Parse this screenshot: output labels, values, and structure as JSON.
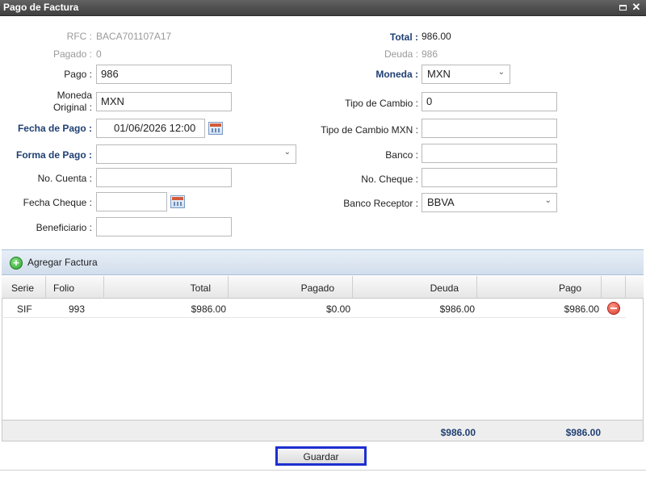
{
  "window": {
    "title": "Pago de Factura"
  },
  "form": {
    "rfc_label": "RFC :",
    "rfc_value": "BACA701107A17",
    "pagado_label": "Pagado :",
    "pagado_value": "0",
    "pago_label": "Pago :",
    "pago_value": "986",
    "moneda_original_label_1": "Moneda",
    "moneda_original_label_2": "Original :",
    "moneda_original_value": "MXN",
    "fecha_pago_label": "Fecha de Pago :",
    "fecha_pago_value": "01/06/2026 12:00",
    "forma_pago_label": "Forma de Pago :",
    "forma_pago_value": "",
    "no_cuenta_label": "No. Cuenta :",
    "no_cuenta_value": "",
    "fecha_cheque_label": "Fecha Cheque :",
    "fecha_cheque_value": "",
    "beneficiario_label": "Beneficiario :",
    "beneficiario_value": "",
    "total_label": "Total :",
    "total_value": "986.00",
    "deuda_label": "Deuda :",
    "deuda_value": "986",
    "moneda_label": "Moneda :",
    "moneda_value": "MXN",
    "tipo_cambio_label": "Tipo de Cambio :",
    "tipo_cambio_value": "0",
    "tipo_cambio_mxn_label": "Tipo de Cambio MXN :",
    "tipo_cambio_mxn_value": "",
    "banco_label": "Banco :",
    "banco_value": "",
    "no_cheque_label": "No. Cheque :",
    "no_cheque_value": "",
    "banco_receptor_label": "Banco Receptor :",
    "banco_receptor_value": "BBVA"
  },
  "invoices": {
    "add_label": "Agregar Factura",
    "columns": [
      "Serie",
      "Folio",
      "Total",
      "Pagado",
      "Deuda",
      "Pago"
    ],
    "rows": [
      {
        "serie": "SIF",
        "folio": "993",
        "total": "$986.00",
        "pagado": "$0.00",
        "deuda": "$986.00",
        "pago": "$986.00"
      }
    ],
    "footer": {
      "deuda": "$986.00",
      "pago": "$986.00"
    }
  },
  "actions": {
    "save_label": "Guardar"
  },
  "icons": {
    "restore": "restore-icon",
    "close": "close-icon",
    "calendar": "calendar-icon",
    "add": "add-circle-icon",
    "remove": "remove-circle-icon"
  },
  "colors": {
    "label_accent": "#1f3f73",
    "save_border": "#1d2fd0",
    "add_green": "#2aa12a",
    "remove_red": "#d8352a"
  }
}
